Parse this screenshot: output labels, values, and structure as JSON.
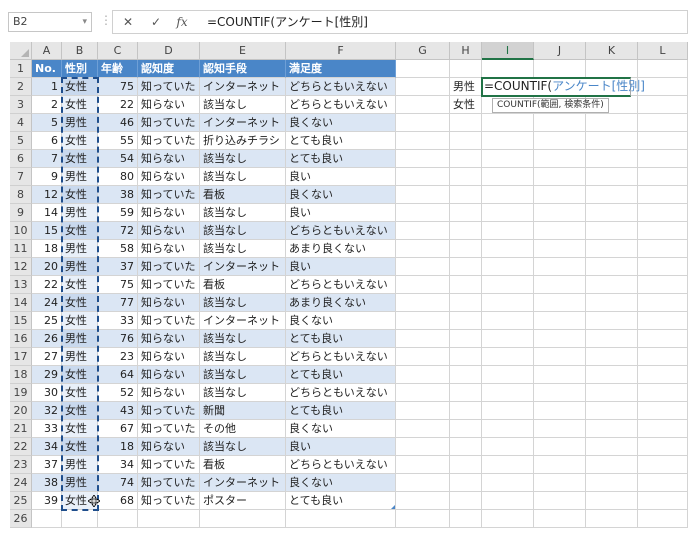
{
  "name_box": "B2",
  "formula": "=COUNTIF(アンケート[性別]",
  "formula_buttons": {
    "cancel": "✕",
    "enter": "✓",
    "fx": "fx"
  },
  "columns": [
    "A",
    "B",
    "C",
    "D",
    "E",
    "F",
    "G",
    "H",
    "I",
    "J",
    "K",
    "L"
  ],
  "table_headers": [
    "No.",
    "性別",
    "年齢",
    "認知度",
    "認知手段",
    "満足度"
  ],
  "rows": [
    [
      "1",
      "女性",
      "75",
      "知っていた",
      "インターネット",
      "どちらともいえない"
    ],
    [
      "2",
      "女性",
      "22",
      "知らない",
      "該当なし",
      "どちらともいえない"
    ],
    [
      "5",
      "男性",
      "46",
      "知っていた",
      "インターネット",
      "良くない"
    ],
    [
      "6",
      "女性",
      "55",
      "知っていた",
      "折り込みチラシ",
      "とても良い"
    ],
    [
      "7",
      "女性",
      "54",
      "知らない",
      "該当なし",
      "とても良い"
    ],
    [
      "9",
      "男性",
      "80",
      "知らない",
      "該当なし",
      "良い"
    ],
    [
      "12",
      "女性",
      "38",
      "知っていた",
      "看板",
      "良くない"
    ],
    [
      "14",
      "男性",
      "59",
      "知らない",
      "該当なし",
      "良い"
    ],
    [
      "15",
      "女性",
      "72",
      "知らない",
      "該当なし",
      "どちらともいえない"
    ],
    [
      "18",
      "男性",
      "58",
      "知らない",
      "該当なし",
      "あまり良くない"
    ],
    [
      "20",
      "男性",
      "37",
      "知っていた",
      "インターネット",
      "良い"
    ],
    [
      "22",
      "女性",
      "75",
      "知っていた",
      "看板",
      "どちらともいえない"
    ],
    [
      "24",
      "女性",
      "77",
      "知らない",
      "該当なし",
      "あまり良くない"
    ],
    [
      "25",
      "女性",
      "33",
      "知っていた",
      "インターネット",
      "良くない"
    ],
    [
      "26",
      "男性",
      "76",
      "知らない",
      "該当なし",
      "とても良い"
    ],
    [
      "27",
      "男性",
      "23",
      "知らない",
      "該当なし",
      "どちらともいえない"
    ],
    [
      "29",
      "女性",
      "64",
      "知らない",
      "該当なし",
      "とても良い"
    ],
    [
      "30",
      "女性",
      "52",
      "知らない",
      "該当なし",
      "どちらともいえない"
    ],
    [
      "32",
      "女性",
      "43",
      "知っていた",
      "新聞",
      "とても良い"
    ],
    [
      "33",
      "女性",
      "67",
      "知っていた",
      "その他",
      "良くない"
    ],
    [
      "34",
      "女性",
      "18",
      "知らない",
      "該当なし",
      "良い"
    ],
    [
      "37",
      "男性",
      "34",
      "知っていた",
      "看板",
      "どちらともいえない"
    ],
    [
      "38",
      "男性",
      "74",
      "知っていた",
      "インターネット",
      "良くない"
    ],
    [
      "39",
      "女性",
      "68",
      "知っていた",
      "ポスター",
      "とても良い"
    ]
  ],
  "side": {
    "h2": "男性",
    "h3": "女性",
    "i2_prefix": "=COUNTIF(",
    "i2_ref": "アンケート[性別]",
    "tooltip": "COUNTIF(範囲, 検索条件)"
  },
  "colors": {
    "table_header": "#4a86c8",
    "band": "#dbe6f4",
    "ref_blue": "#4a86c8",
    "active_border": "#217346"
  }
}
